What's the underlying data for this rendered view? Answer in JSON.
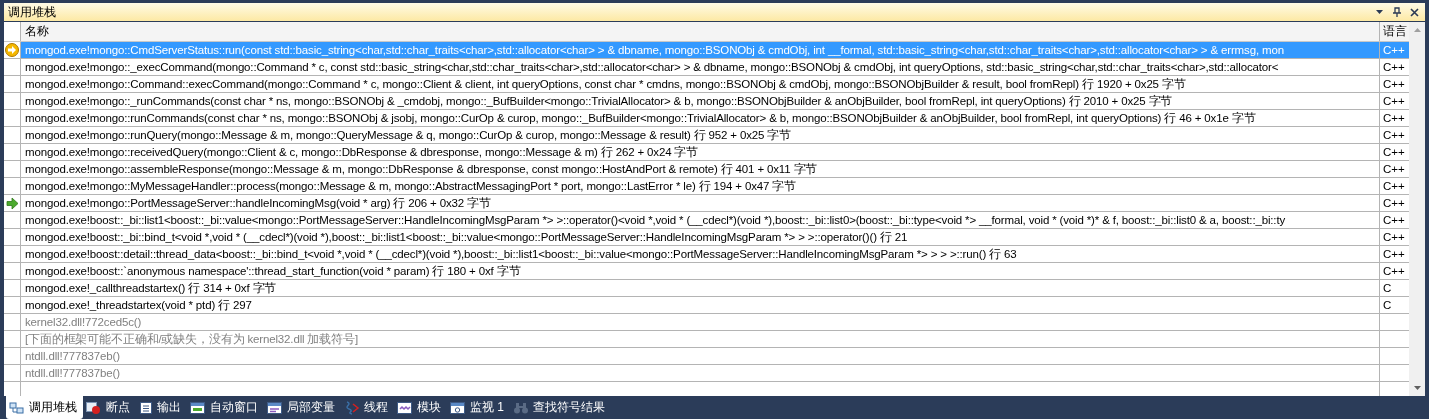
{
  "window": {
    "title": "调用堆栈"
  },
  "table": {
    "columns": [
      "名称",
      "语言"
    ],
    "rows": [
      {
        "name": "mongod.exe!mongo::CmdServerStatus::run(const std::basic_string<char,std::char_traits<char>,std::allocator<char> > & dbname, mongo::BSONObj & cmdObj, int __formal, std::basic_string<char,std::char_traits<char>,std::allocator<char> > & errmsg, mon",
        "language": "C++",
        "selected": true,
        "kind": "current",
        "dim": false
      },
      {
        "name": "mongod.exe!mongo::_execCommand(mongo::Command * c, const std::basic_string<char,std::char_traits<char>,std::allocator<char> > & dbname, mongo::BSONObj & cmdObj, int queryOptions, std::basic_string<char,std::char_traits<char>,std::allocator<",
        "language": "C++",
        "selected": false,
        "kind": "plain",
        "dim": false
      },
      {
        "name": "mongod.exe!mongo::Command::execCommand(mongo::Command * c, mongo::Client & client, int queryOptions, const char * cmdns, mongo::BSONObj & cmdObj, mongo::BSONObjBuilder & result, bool fromRepl)  行 1920 + 0x25 字节",
        "language": "C++",
        "selected": false,
        "kind": "plain",
        "dim": false
      },
      {
        "name": "mongod.exe!mongo::_runCommands(const char * ns, mongo::BSONObj & _cmdobj, mongo::_BufBuilder<mongo::TrivialAllocator> & b, mongo::BSONObjBuilder & anObjBuilder, bool fromRepl, int queryOptions)  行 2010 + 0x25 字节",
        "language": "C++",
        "selected": false,
        "kind": "plain",
        "dim": false
      },
      {
        "name": "mongod.exe!mongo::runCommands(const char * ns, mongo::BSONObj & jsobj, mongo::CurOp & curop, mongo::_BufBuilder<mongo::TrivialAllocator> & b, mongo::BSONObjBuilder & anObjBuilder, bool fromRepl, int queryOptions)  行 46 + 0x1e 字节",
        "language": "C++",
        "selected": false,
        "kind": "plain",
        "dim": false
      },
      {
        "name": "mongod.exe!mongo::runQuery(mongo::Message & m, mongo::QueryMessage & q, mongo::CurOp & curop, mongo::Message & result)  行 952 + 0x25 字节",
        "language": "C++",
        "selected": false,
        "kind": "plain",
        "dim": false
      },
      {
        "name": "mongod.exe!mongo::receivedQuery(mongo::Client & c, mongo::DbResponse & dbresponse, mongo::Message & m)  行 262 + 0x24 字节",
        "language": "C++",
        "selected": false,
        "kind": "plain",
        "dim": false
      },
      {
        "name": "mongod.exe!mongo::assembleResponse(mongo::Message & m, mongo::DbResponse & dbresponse, const mongo::HostAndPort & remote)  行 401 + 0x11 字节",
        "language": "C++",
        "selected": false,
        "kind": "plain",
        "dim": false
      },
      {
        "name": "mongod.exe!mongo::MyMessageHandler::process(mongo::Message & m, mongo::AbstractMessagingPort * port, mongo::LastError * le)  行 194 + 0x47 字节",
        "language": "C++",
        "selected": false,
        "kind": "plain",
        "dim": false
      },
      {
        "name": "mongod.exe!mongo::PortMessageServer::handleIncomingMsg(void * arg)  行 206 + 0x32 字节",
        "language": "C++",
        "selected": false,
        "kind": "caller",
        "dim": false
      },
      {
        "name": "mongod.exe!boost::_bi::list1<boost::_bi::value<mongo::PortMessageServer::HandleIncomingMsgParam *> >::operator()<void *,void * (__cdecl*)(void *),boost::_bi::list0>(boost::_bi::type<void *> __formal, void * (void *)* & f, boost::_bi::list0 & a, boost::_bi::ty",
        "language": "C++",
        "selected": false,
        "kind": "plain",
        "dim": false
      },
      {
        "name": "mongod.exe!boost::_bi::bind_t<void *,void * (__cdecl*)(void *),boost::_bi::list1<boost::_bi::value<mongo::PortMessageServer::HandleIncomingMsgParam *> > >::operator()()  行 21",
        "language": "C++",
        "selected": false,
        "kind": "plain",
        "dim": false
      },
      {
        "name": "mongod.exe!boost::detail::thread_data<boost::_bi::bind_t<void *,void * (__cdecl*)(void *),boost::_bi::list1<boost::_bi::value<mongo::PortMessageServer::HandleIncomingMsgParam *> > > >::run()  行 63",
        "language": "C++",
        "selected": false,
        "kind": "plain",
        "dim": false
      },
      {
        "name": "mongod.exe!boost::`anonymous namespace'::thread_start_function(void * param)  行 180 + 0xf 字节",
        "language": "C++",
        "selected": false,
        "kind": "plain",
        "dim": false
      },
      {
        "name": "mongod.exe!_callthreadstartex()  行 314 + 0xf 字节",
        "language": "C",
        "selected": false,
        "kind": "plain",
        "dim": false
      },
      {
        "name": "mongod.exe!_threadstartex(void * ptd)  行 297",
        "language": "C",
        "selected": false,
        "kind": "plain",
        "dim": false
      },
      {
        "name": "kernel32.dll!772ced5c()",
        "selected": false,
        "kind": "plain",
        "dim": true
      },
      {
        "name": "[下面的框架可能不正确和/或缺失，没有为 kernel32.dll 加载符号]",
        "selected": false,
        "kind": "plain",
        "dim": true
      },
      {
        "name": "ntdll.dll!777837eb()",
        "selected": false,
        "kind": "plain",
        "dim": true
      },
      {
        "name": "ntdll.dll!777837be()",
        "selected": false,
        "kind": "plain",
        "dim": true
      }
    ]
  },
  "tabs": [
    {
      "label": "调用堆栈",
      "kind": "callstack",
      "selected": true
    },
    {
      "label": "断点",
      "kind": "breakpoint",
      "selected": false
    },
    {
      "label": "输出",
      "kind": "output",
      "selected": false
    },
    {
      "label": "自动窗口",
      "kind": "auto",
      "selected": false
    },
    {
      "label": "局部变量",
      "kind": "locals",
      "selected": false
    },
    {
      "label": "线程",
      "kind": "threads",
      "selected": false
    },
    {
      "label": "模块",
      "kind": "modules",
      "selected": false
    },
    {
      "label": "监视 1",
      "kind": "watch",
      "selected": false
    },
    {
      "label": "查找符号结果",
      "kind": "find",
      "selected": false
    }
  ]
}
